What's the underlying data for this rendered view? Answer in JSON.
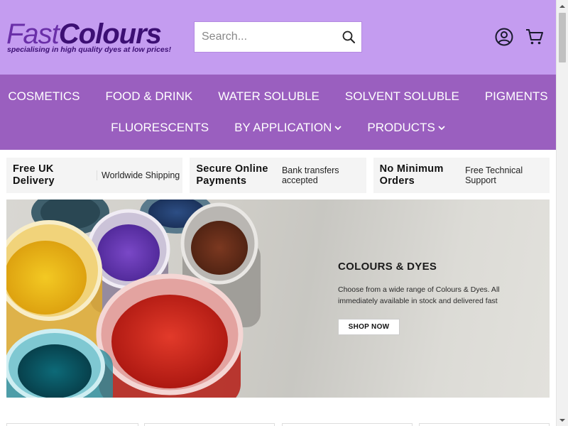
{
  "header": {
    "logo_fast": "Fast",
    "logo_colours": "Colours",
    "logo_tagline": "specialising in high quality dyes at low prices!",
    "search_placeholder": "Search...",
    "icons": {
      "search": "search-icon",
      "account": "account-icon",
      "cart": "cart-icon"
    },
    "colors": {
      "header_bg": "#c49cf0",
      "brand_dark": "#3c0f73",
      "brand_light": "#6a2fa8"
    }
  },
  "nav": {
    "row1": [
      "COSMETICS",
      "FOOD & DRINK",
      "WATER SOLUBLE",
      "SOLVENT SOLUBLE",
      "PIGMENTS"
    ],
    "row2": [
      "FLUORESCENTS",
      "BY APPLICATION",
      "PRODUCTS"
    ],
    "bg_color": "#9a5fbf"
  },
  "features": [
    {
      "title": "Free UK Delivery",
      "subtitle": "Worldwide Shipping"
    },
    {
      "title": "Secure Online Payments",
      "subtitle": "Bank transfers accepted"
    },
    {
      "title": "No Minimum Orders",
      "subtitle": "Free Technical Support"
    }
  ],
  "hero": {
    "title": "COLOURS & DYES",
    "text": "Choose from a wide range of Colours & Dyes. All immediately available in stock and delivered fast",
    "button": "SHOP NOW"
  }
}
